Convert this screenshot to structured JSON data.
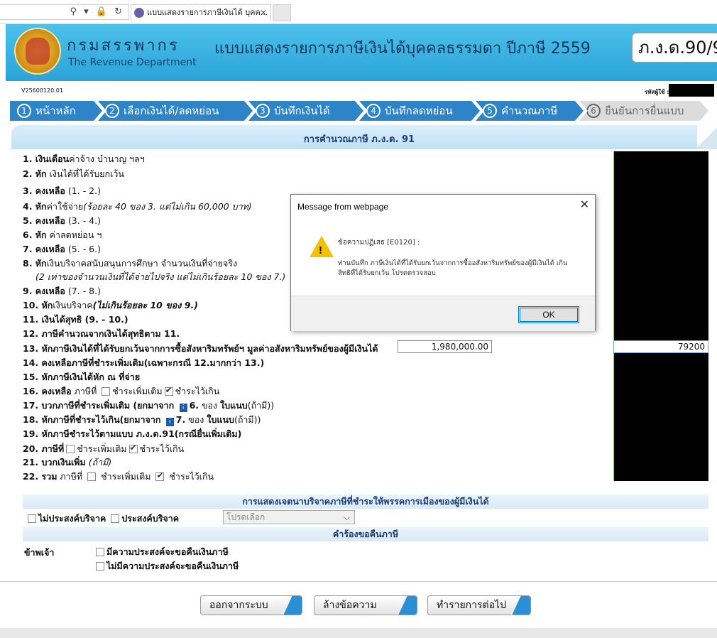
{
  "browser": {
    "tab_title": "แบบแสดงรายการภาษีเงินได้ บุคค...",
    "tab_close": "✕",
    "addr_icons": "⚲ ▾ 🔒 ↻"
  },
  "header": {
    "dept_th": "กรมสรรพากร",
    "dept_en": "The Revenue Department",
    "form_title": "แบบแสดงรายการภาษีเงินได้บุคคลธรรมดา ปีภาษี 2559",
    "form_code": "ภ.ง.ด.90/9"
  },
  "meta": {
    "doc_id": "V25600120.01",
    "taxid_label": "รหัสผู้ใช้ :"
  },
  "steps": [
    {
      "num": "1",
      "label": "หน้าหลัก"
    },
    {
      "num": "2",
      "label": "เลือกเงินได้/ลดหย่อน"
    },
    {
      "num": "3",
      "label": "บันทึกเงินได้"
    },
    {
      "num": "4",
      "label": "บันทึกลดหย่อน"
    },
    {
      "num": "5",
      "label": "คำนวณภาษี"
    },
    {
      "num": "6",
      "label": "ยืนยันการยื่นแบบ"
    }
  ],
  "section_title": "การคำนวณภาษี ภ.ง.ด. 91",
  "items": {
    "i1a": "1. เงินเดือน",
    "i1b": "ค่าจ้าง บำนาญ ฯลฯ",
    "i2a": "2. หัก",
    "i2b": " เงินได้ที่ได้รับยกเว้น",
    "i3a": "3. คงเหลือ",
    "i3b": " (1. - 2.)",
    "i4a": "4. หัก",
    "i4b": "ค่าใช้จ่าย",
    "i4c": "(ร้อยละ 40 ของ 3. แต่ไม่เกิน 60,000 บาท)",
    "i5a": "5. คงเหลือ",
    "i5b": " (3. - 4.)",
    "i6a": "6. หัก",
    "i6b": " ค่าลดหย่อน ฯ",
    "i7a": "7. คงเหลือ",
    "i7b": " (5. - 6.)",
    "i8a": "8. หัก",
    "i8b": "เงินบริจาคสนับสนุนการศึกษา จำนวนเงินที่จ่ายจริง",
    "i8c": "(2 เท่าของจำนวนเงินที่ได้จ่ายไปจริง แต่ไม่เกินร้อยละ 10 ของ 7.)",
    "i9a": "9. คงเหลือ",
    "i9b": " (7. - 8.)",
    "i10a": "10. หัก",
    "i10b": "เงินบริจาค",
    "i10c": "(ไม่เกินร้อยละ 10 ของ 9.)",
    "i11": "11. เงินได้สุทธิ (9. - 10.)",
    "i12": "12. ภาษีคำนวณจากเงินได้สุทธิตาม 11.",
    "i13": "13. หักภาษีเงินได้ที่ได้รับยกเว้นจากการซื้อสังหาริมทรัพย์ฯ มูลค่าอสังหาริมทรัพย์ของผู้มีเงินได้",
    "i13_amount": "1,980,000.00",
    "i14": "14. คงเหลือภาษีที่ชำระเพิ่มเติม(เฉพาะกรณี 12.มากกว่า 13.)",
    "i15": "15. หักภาษีเงินได้หัก ณ ที่จ่าย",
    "i16a": "16. คงเหลือ",
    "i16b": " ภาษีที่ ",
    "i16c": "ชำระเพิ่มเติม",
    "i16d": "ชำระไว้เกิน",
    "i17a": "17. บวกภาษีที่ชำระเพิ่มเติม (ยกมาจาก ",
    "i17b": "6.",
    "i17c": " ของ ",
    "i17d": "ใบแนบ",
    "i17e": "(ถ้ามี))",
    "i18a": "18. หักภาษีที่ชำระไว้เกิน(ยกมาจาก ",
    "i18b": "7.",
    "i18c": " ของ ",
    "i18d": "ใบแนบ",
    "i18e": "(ถ้ามี))",
    "i19": "19. หักภาษีชำระไว้ตามแบบ ภ.ง.ด.91(กรณียื่นเพิ่มเติม)",
    "i20a": "20. ภาษีที่",
    "i20b": "ชำระเพิ่มเติม",
    "i20c": "ชำระไว้เกิน",
    "i21a": "21. บวกเงินเพิ่ม",
    "i21b": "(ถ้ามี)",
    "i22a": "22. รวม",
    "i22b": " ภาษีที่",
    "i22c": "ชำระเพิ่มเติม",
    "i22d": "ชำระไว้เกิน",
    "info_icon": "i"
  },
  "value_13": "79200",
  "donation": {
    "title": "การแสดงเจตนาบริจาคภาษีที่ชำระให้พรรคการเมืองของผู้มีเงินได้",
    "no_donate": "ไม่ประสงค์บริจาค",
    "donate": "ประสงค์บริจาค",
    "select_value": "โปรดเลือก"
  },
  "refund": {
    "title": "คำร้องขอคืนภาษี",
    "label": "ข้าพเจ้า",
    "opt_yes": "มีความประสงค์จะขอคืนเงินภาษี",
    "opt_no": "ไม่มีความประสงค์จะขอคืนเงินภาษี"
  },
  "buttons": {
    "logout": "ออกจากระบบ",
    "clear": "ล้างข้อความ",
    "next": "ทำรายการต่อไป"
  },
  "dialog": {
    "title": "Message from webpage",
    "msg1": "ข้อความปฏิเสธ [E0120] :",
    "msg2": "ท่านบันทึก ภาษีเงินได้ที่ได้รับยกเว้นจากการซื้ออสังหาริมทรัพย์ของผู้มีเงินได้ เกินสิทธิที่ได้รับยกเว้น โปรดตรวจสอบ",
    "ok": "OK",
    "close": "✕",
    "warn_mark": "!"
  }
}
